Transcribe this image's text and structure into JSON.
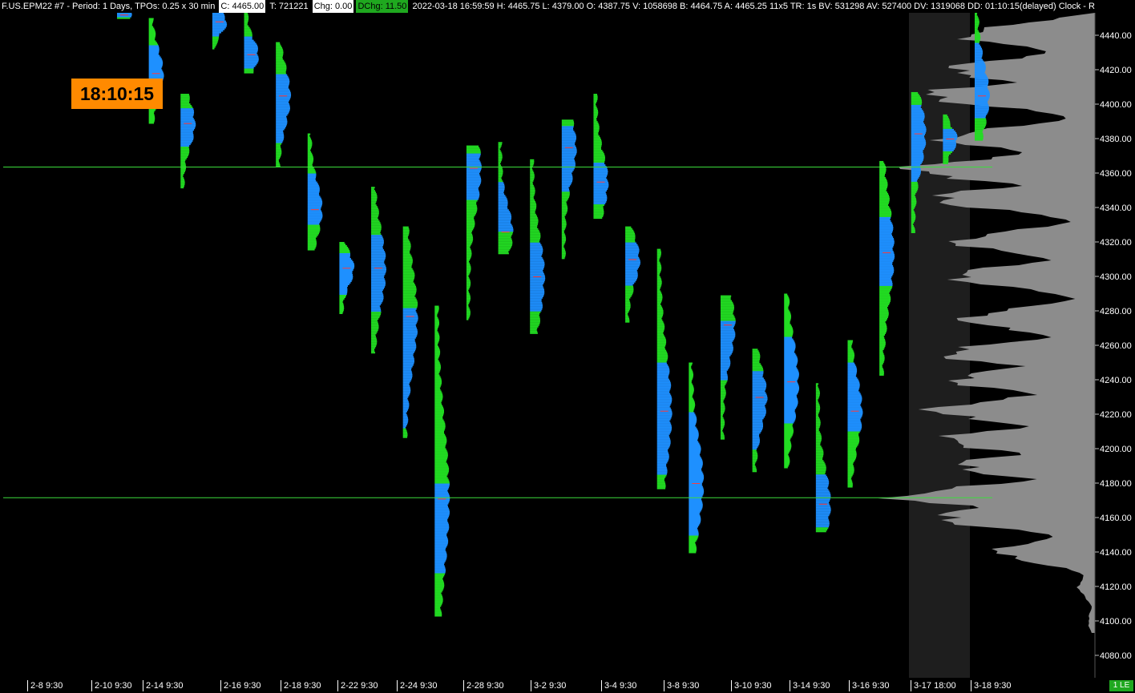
{
  "header": {
    "symbol_info": "F.US.EPM22  #7 - Period: 1 Days, TPOs: 0.25 x 30 min",
    "close": "C: 4465.00",
    "ticks": "T: 721221",
    "change": "Chg: 0.00",
    "dchange": "DChg: 11.50",
    "stats": "2022-03-18 16:59:59 H: 4465.75 L: 4379.00 O: 4387.75 V: 1058698 B: 4464.75 A: 4465.25 11x5 TR: 1s BV: 531298 AV: 527400 DV: 1319068 DD: 01:10:15(delayed) Clock - R"
  },
  "clock": "18:10:15",
  "status": "1 LE",
  "colors": {
    "background": "#000000",
    "tpo_blue": "#1e90ff",
    "tpo_green": "#22dd22",
    "ref_line": "#3cdc3c",
    "volume_profile": "#8c8c8c",
    "session_shade": "#1e1e1e",
    "clock_badge": "#ff8a00"
  },
  "chart_data": {
    "type": "tpo-profile",
    "title": "F.US.EPM22 #7 - Period: 1 Days, TPOs: 0.25 x 30 min",
    "y_axis": {
      "ticks": [
        4080,
        4100,
        4120,
        4140,
        4160,
        4180,
        4200,
        4220,
        4240,
        4260,
        4280,
        4300,
        4320,
        4340,
        4360,
        4380,
        4400,
        4420,
        4440
      ],
      "ylim": [
        4072,
        4456
      ],
      "grid": false
    },
    "x_ticks": [
      "2-8  9:30",
      "2-10  9:30",
      "2-14  9:30",
      "2-16  9:30",
      "2-18  9:30",
      "2-22  9:30",
      "2-24  9:30",
      "2-28  9:30",
      "3-2  9:30",
      "3-4  9:30",
      "3-8  9:30",
      "3-10  9:30",
      "3-14  9:30",
      "3-16  9:30",
      "3-17  18:00",
      "3-18  9:30"
    ],
    "reference_lines": [
      4363.5,
      4171.5
    ],
    "profiles": [
      {
        "date": "2-8",
        "high": 4456,
        "low": 4450,
        "poc": 4452,
        "va_high": 4455,
        "va_low": 4451
      },
      {
        "date": "2-9",
        "high": 4450,
        "low": 4389,
        "poc": 4418,
        "va_high": 4435,
        "va_low": 4400
      },
      {
        "date": "2-10",
        "high": 4406,
        "low": 4352,
        "poc": 4389,
        "va_high": 4398,
        "va_low": 4376
      },
      {
        "date": "2-11",
        "high": 4456,
        "low": 4432,
        "poc": 4448,
        "va_high": 4455,
        "va_low": 4440
      },
      {
        "date": "2-14",
        "high": 4456,
        "low": 4418,
        "poc": 4429,
        "va_high": 4440,
        "va_low": 4421
      },
      {
        "date": "2-15",
        "high": 4436,
        "low": 4364,
        "poc": 4405,
        "va_high": 4418,
        "va_low": 4378
      },
      {
        "date": "2-16",
        "high": 4383,
        "low": 4316,
        "poc": 4339,
        "va_high": 4360,
        "va_low": 4330
      },
      {
        "date": "2-17",
        "high": 4320,
        "low": 4279,
        "poc": 4305,
        "va_high": 4314,
        "va_low": 4290
      },
      {
        "date": "2-18",
        "high": 4352,
        "low": 4256,
        "poc": 4305,
        "va_high": 4325,
        "va_low": 4280
      },
      {
        "date": "2-22",
        "high": 4329,
        "low": 4207,
        "poc": 4277,
        "va_high": 4282,
        "va_low": 4212
      },
      {
        "date": "2-23",
        "high": 4283,
        "low": 4103,
        "poc": 4171,
        "va_high": 4180,
        "va_low": 4128
      },
      {
        "date": "2-24",
        "high": 4376,
        "low": 4275,
        "poc": 4363,
        "va_high": 4372,
        "va_low": 4345
      },
      {
        "date": "2-25",
        "high": 4378,
        "low": 4313,
        "poc": 4326,
        "va_high": 4355,
        "va_low": 4326
      },
      {
        "date": "2-28",
        "high": 4368,
        "low": 4267,
        "poc": 4300,
        "va_high": 4320,
        "va_low": 4280
      },
      {
        "date": "3-1",
        "high": 4391,
        "low": 4311,
        "poc": 4375,
        "va_high": 4388,
        "va_low": 4350
      },
      {
        "date": "3-2",
        "high": 4406,
        "low": 4334,
        "poc": 4355,
        "va_high": 4366,
        "va_low": 4342
      },
      {
        "date": "3-3",
        "high": 4329,
        "low": 4274,
        "poc": 4310,
        "va_high": 4320,
        "va_low": 4295
      },
      {
        "date": "3-4",
        "high": 4316,
        "low": 4177,
        "poc": 4222,
        "va_high": 4250,
        "va_low": 4185
      },
      {
        "date": "3-7",
        "high": 4250,
        "low": 4140,
        "poc": 4180,
        "va_high": 4222,
        "va_low": 4150
      },
      {
        "date": "3-8",
        "high": 4289,
        "low": 4206,
        "poc": 4272,
        "va_high": 4275,
        "va_low": 4240
      },
      {
        "date": "3-9",
        "high": 4258,
        "low": 4187,
        "poc": 4230,
        "va_high": 4245,
        "va_low": 4200
      },
      {
        "date": "3-10",
        "high": 4290,
        "low": 4189,
        "poc": 4239,
        "va_high": 4265,
        "va_low": 4215
      },
      {
        "date": "3-11",
        "high": 4238,
        "low": 4152,
        "poc": 4168,
        "va_high": 4185,
        "va_low": 4155
      },
      {
        "date": "3-14",
        "high": 4263,
        "low": 4178,
        "poc": 4222,
        "va_high": 4250,
        "va_low": 4210
      },
      {
        "date": "3-15",
        "high": 4367,
        "low": 4243,
        "poc": 4314,
        "va_high": 4335,
        "va_low": 4295
      },
      {
        "date": "3-16",
        "high": 4407,
        "low": 4326,
        "poc": 4383,
        "va_high": 4400,
        "va_low": 4355
      },
      {
        "date": "3-17",
        "high": 4394,
        "low": 4366,
        "poc": 4380,
        "va_high": 4386,
        "va_low": 4373
      },
      {
        "date": "3-18",
        "high": 4456,
        "low": 4379,
        "poc": 4405,
        "va_high": 4436,
        "va_low": 4392
      }
    ]
  }
}
